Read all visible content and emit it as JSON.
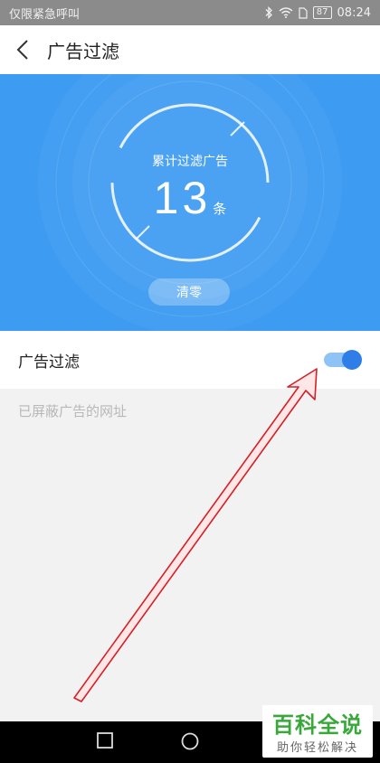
{
  "status_bar": {
    "carrier_text": "仅限紧急呼叫",
    "battery": "87",
    "time": "08:24",
    "icons": [
      "bluetooth-icon",
      "wifi-icon",
      "sim-icon",
      "battery-icon"
    ]
  },
  "header": {
    "title": "广告过滤",
    "back_icon": "chevron-left-icon"
  },
  "hero": {
    "label": "累计过滤广告",
    "count": "13",
    "unit": "条",
    "clear_button": "清零",
    "background_color": "#3d9cf2"
  },
  "setting": {
    "label": "广告过滤",
    "toggle_on": true,
    "accent_color": "#2f7ee8"
  },
  "blocked_link": "已屏蔽广告的网址",
  "bottom_nav": {
    "icons": [
      "recent-apps-icon",
      "home-icon",
      "back-icon"
    ]
  },
  "watermark": {
    "title": "百科全说",
    "subtitle": "助你轻松解决"
  },
  "annotation": {
    "color": "#e0202a",
    "points_to": "toggle"
  }
}
